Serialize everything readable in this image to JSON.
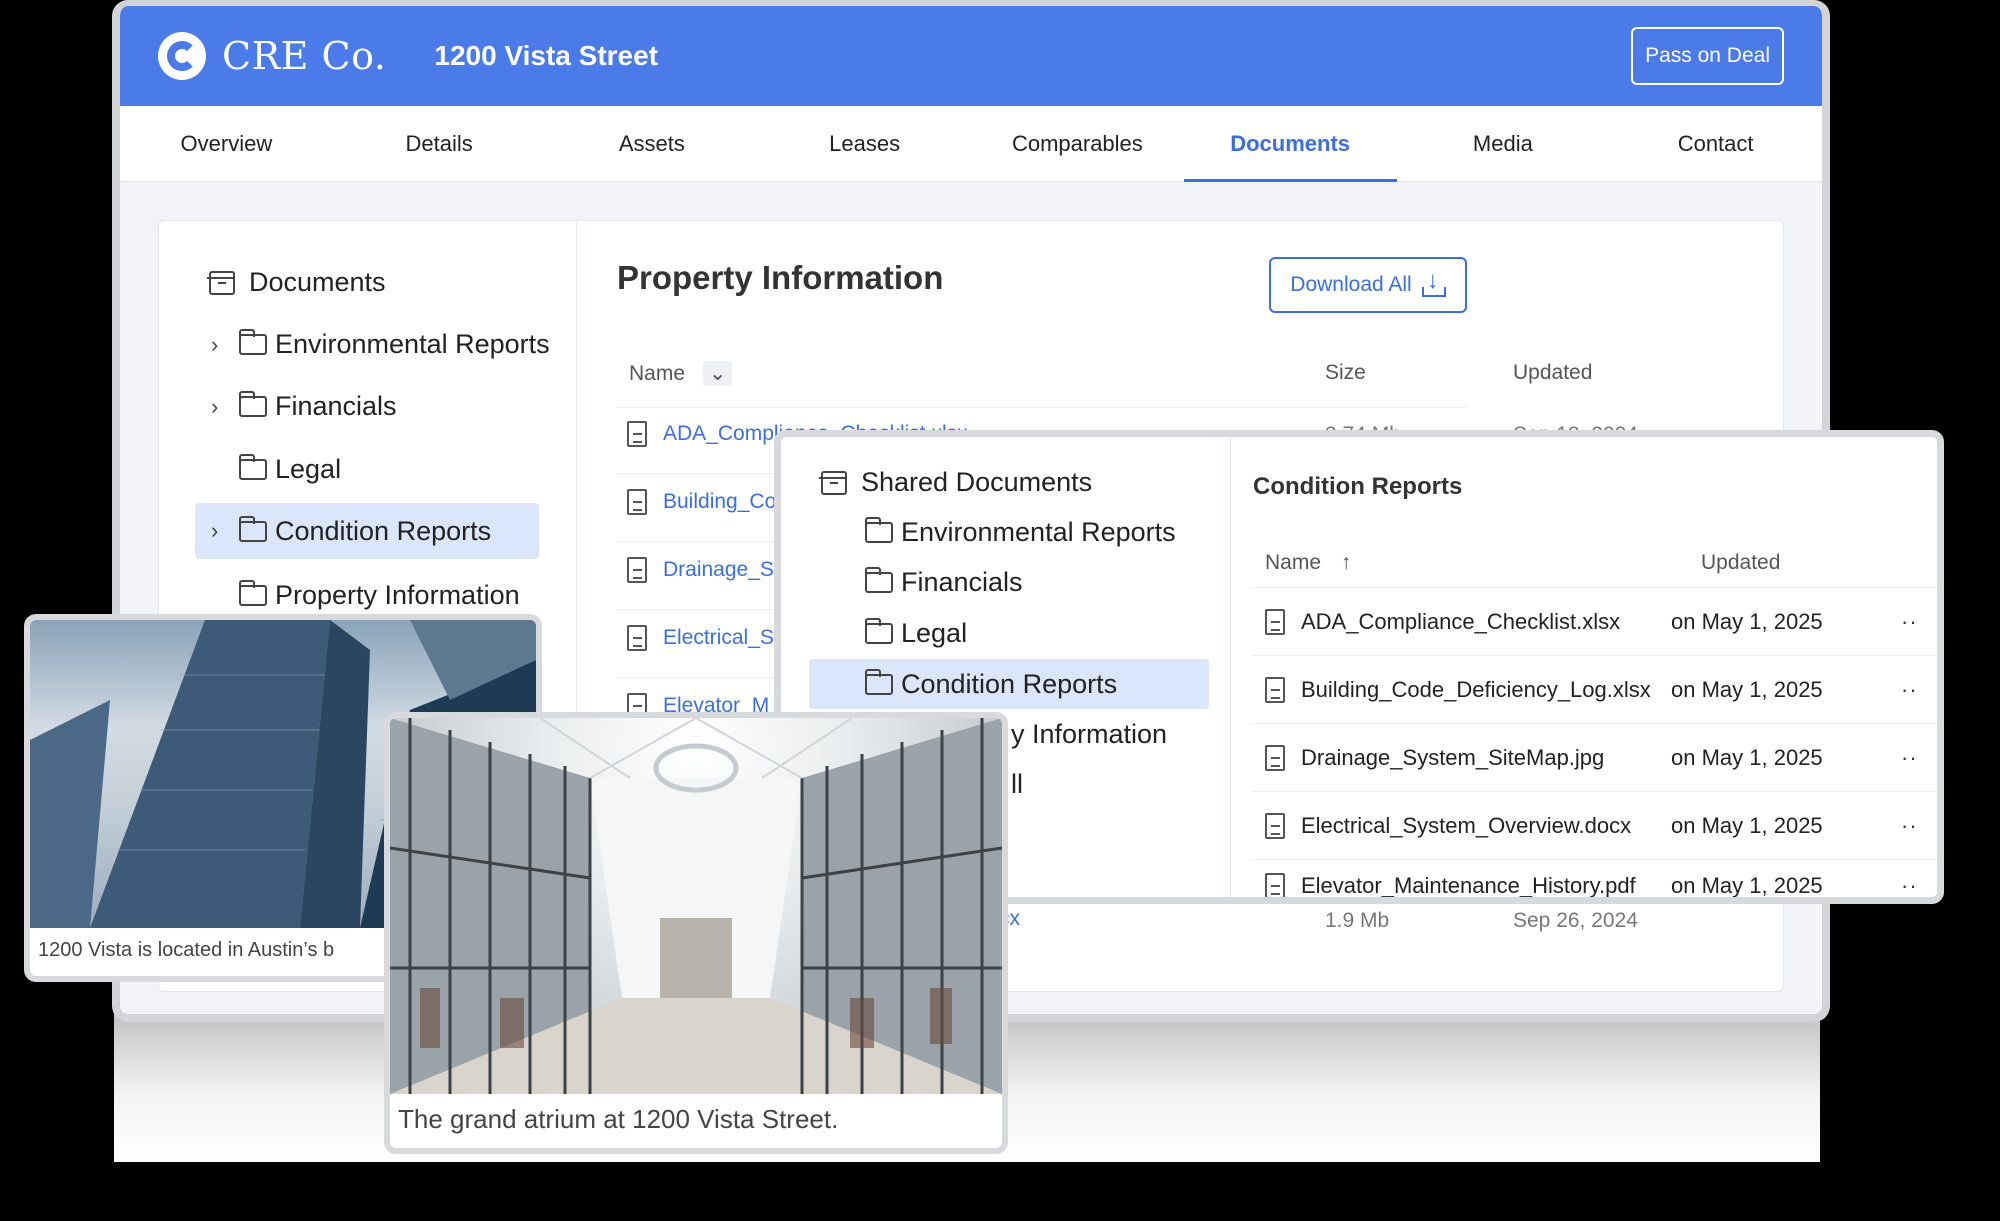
{
  "header": {
    "brand": "CRE Co.",
    "deal_title": "1200 Vista Street",
    "pass_label": "Pass on Deal"
  },
  "tabs": [
    "Overview",
    "Details",
    "Assets",
    "Leases",
    "Comparables",
    "Documents",
    "Media",
    "Contact"
  ],
  "active_tab": "Documents",
  "tree": {
    "root": "Documents",
    "items": [
      "Environmental Reports",
      "Financials",
      "Legal",
      "Condition Reports",
      "Property Information"
    ]
  },
  "docs": {
    "title": "Property Information",
    "download_label": "Download All",
    "columns": {
      "name": "Name",
      "size": "Size",
      "updated": "Updated"
    },
    "rows": [
      {
        "name": "ADA_Compliance_Checklist.xlsx",
        "size": "3.74 Mb",
        "updated": "Sep 12, 2024"
      },
      {
        "name": "Building_Co",
        "size": "",
        "updated": ""
      },
      {
        "name": "Drainage_S",
        "size": "",
        "updated": ""
      },
      {
        "name": "Electrical_S",
        "size": "",
        "updated": ""
      },
      {
        "name": "Elevator_M",
        "size": "",
        "updated": ""
      }
    ],
    "last_row": {
      "name_tail": "cx",
      "size": "1.9 Mb",
      "updated": "Sep 26, 2024"
    }
  },
  "shared": {
    "root": "Shared Documents",
    "items": [
      "Environmental Reports",
      "Financials",
      "Legal",
      "Condition Reports"
    ],
    "partial_item": "y Information",
    "partial_item2": "ll",
    "title": "Condition Reports",
    "columns": {
      "name": "Name",
      "updated": "Updated"
    },
    "rows": [
      {
        "name": "ADA_Compliance_Checklist.xlsx",
        "updated": "on May 1, 2025"
      },
      {
        "name": "Building_Code_Deficiency_Log.xlsx",
        "updated": "on May 1, 2025"
      },
      {
        "name": "Drainage_System_SiteMap.jpg",
        "updated": "on May 1, 2025"
      },
      {
        "name": "Electrical_System_Overview.docx",
        "updated": "on May 1, 2025"
      },
      {
        "name": "Elevator_Maintenance_History.pdf",
        "updated": "on May 1, 2025"
      }
    ]
  },
  "photos": {
    "tower_caption": "1200 Vista is located in Austin’s b",
    "atrium_caption": "The grand atrium at 1200 Vista Street."
  }
}
